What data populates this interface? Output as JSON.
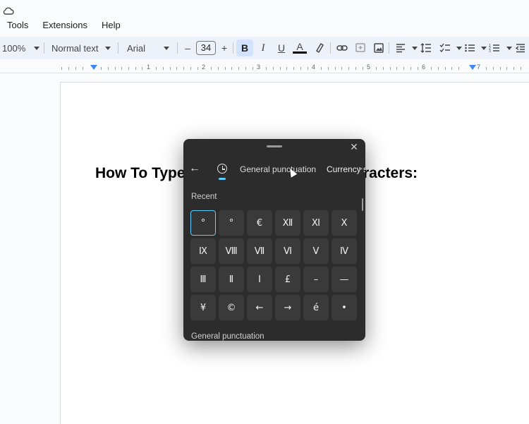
{
  "menubar": {
    "items": [
      "Tools",
      "Extensions",
      "Help"
    ]
  },
  "toolbar": {
    "zoom": "100%",
    "style": "Normal text",
    "font": "Arial",
    "font_size": "34",
    "minus": "–",
    "plus": "+",
    "bold": "B",
    "italic": "I",
    "underline": "U",
    "text_color": "A"
  },
  "ruler": {
    "numbers": [
      "1",
      "2",
      "3",
      "4",
      "5",
      "6",
      "7"
    ]
  },
  "document": {
    "heading_left": "How To Type",
    "heading_right": "racters:"
  },
  "emoji_panel": {
    "close": "✕",
    "back": "←",
    "category_active": "General punctuation",
    "category_next": "Currency s",
    "recent_label": "Recent",
    "bottom_label": "General punctuation",
    "cells": [
      "°",
      "°",
      "€",
      "Ⅻ",
      "Ⅺ",
      "Ⅹ",
      "Ⅸ",
      "Ⅷ",
      "Ⅶ",
      "Ⅵ",
      "Ⅴ",
      "Ⅳ",
      "Ⅲ",
      "Ⅱ",
      "Ⅰ",
      "£",
      "–",
      "—",
      "¥",
      "©",
      "←",
      "→",
      "é",
      "•"
    ],
    "accent_color": "#60cdff"
  }
}
